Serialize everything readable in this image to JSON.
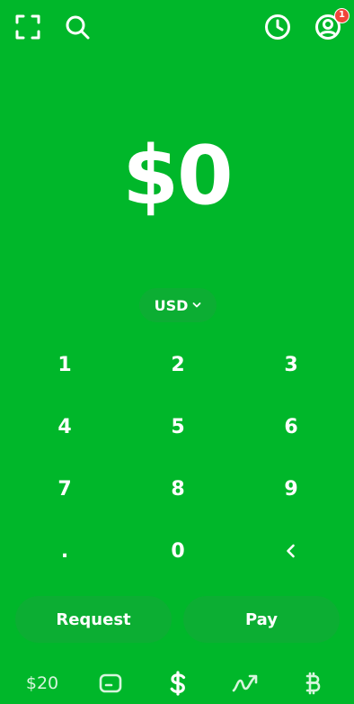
{
  "header": {
    "scan_icon": "scan-icon",
    "search_icon": "search-icon",
    "history_icon": "clock-icon",
    "profile_icon": "profile-icon",
    "notification_count": "1"
  },
  "amount": {
    "value": "$0"
  },
  "currency": {
    "label": "USD",
    "icon": "chevron-down-icon"
  },
  "keypad": {
    "keys": [
      "1",
      "2",
      "3",
      "4",
      "5",
      "6",
      "7",
      "8",
      "9",
      ".",
      "0"
    ],
    "backspace_icon": "chevron-left-icon"
  },
  "actions": {
    "request_label": "Request",
    "pay_label": "Pay"
  },
  "bottom_nav": {
    "balance_label": "$20",
    "items": [
      "card-icon",
      "dollar-icon",
      "investing-icon",
      "bitcoin-icon"
    ]
  },
  "colors": {
    "background": "#00B72A",
    "button": "#0CAE33",
    "badge": "#F0453A",
    "text": "#FFFFFF"
  }
}
